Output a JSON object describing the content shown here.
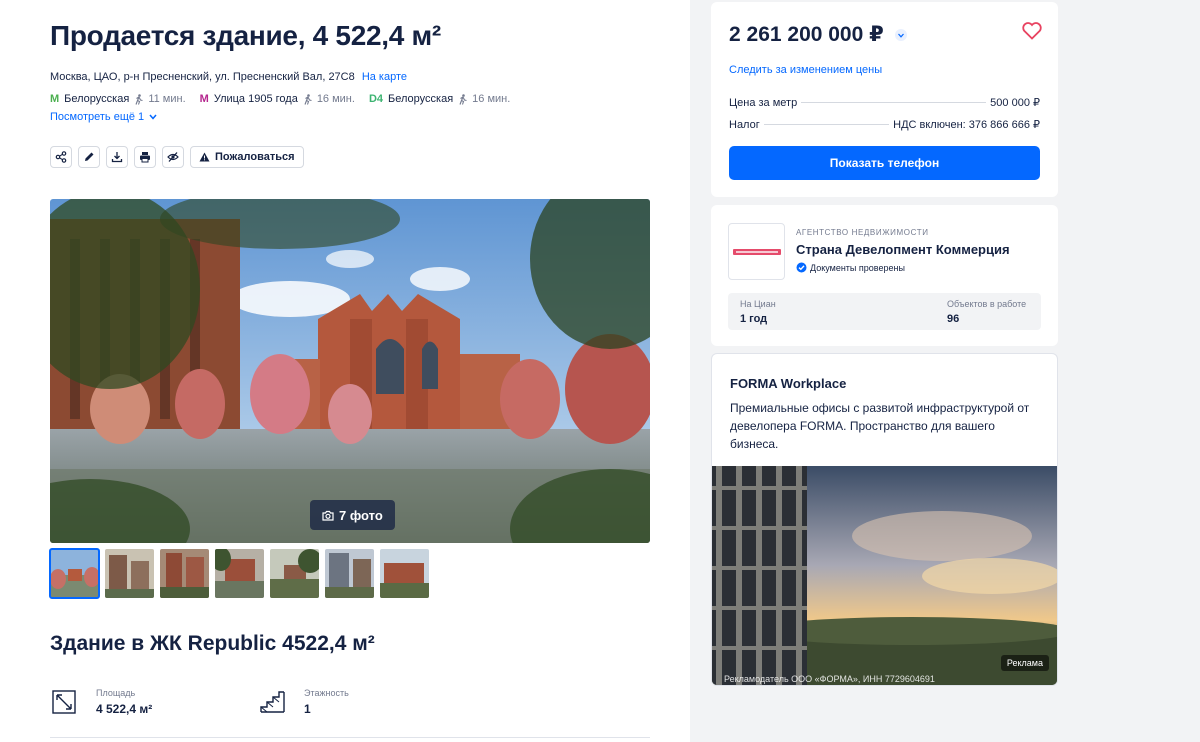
{
  "listing": {
    "title": "Продается здание, 4 522,4 м²",
    "address": "Москва, ЦАО, р-н Пресненский, ул. Пресненский Вал, 27С8",
    "map_link": "На карте",
    "metro": [
      {
        "logo": "M",
        "station": "Белорусская",
        "time": "11 мин.",
        "color": "#4baf4f"
      },
      {
        "logo": "M",
        "station": "Улица 1905 года",
        "time": "16 мин.",
        "color": "#b5268e"
      },
      {
        "logo": "D4",
        "station": "Белорусская",
        "time": "16 мин.",
        "color": "#3cb371"
      }
    ],
    "more_link": "Посмотреть ещё 1",
    "complain_label": "Пожаловаться",
    "photo_count": "7 фото",
    "subtitle": "Здание в ЖК Republic 4522,4 м²",
    "params": [
      {
        "label": "Площадь",
        "value": "4 522,4 м²"
      },
      {
        "label": "Этажность",
        "value": "1"
      }
    ]
  },
  "price_card": {
    "price": "2 261 200 000 ₽",
    "follow_link": "Следить за изменением цены",
    "rows": [
      {
        "label": "Цена за метр",
        "value": "500 000 ₽"
      },
      {
        "label": "Налог",
        "value": "НДС включен: 376 866 666 ₽"
      }
    ],
    "call_button": "Показать телефон"
  },
  "agent_card": {
    "type": "АГЕНТСТВО НЕДВИЖИМОСТИ",
    "name": "Страна Девелопмент Коммерция",
    "verified": "Документы проверены",
    "stats": [
      {
        "label": "На Циан",
        "value": "1 год"
      },
      {
        "label": "Объектов в работе",
        "value": "96"
      }
    ]
  },
  "ad_card": {
    "title": "FORMA Workplace",
    "text": "Премиальные офисы с развитой инфраструктурой от девелопера FORMA. Пространство для вашего бизнеса.",
    "badge": "Реклама",
    "advertiser": "Рекламодатель ООО «ФОРМА», ИНН 7729604691"
  },
  "colors": {
    "accent": "#0468ff",
    "text": "#152242",
    "heart": "#e84260"
  }
}
